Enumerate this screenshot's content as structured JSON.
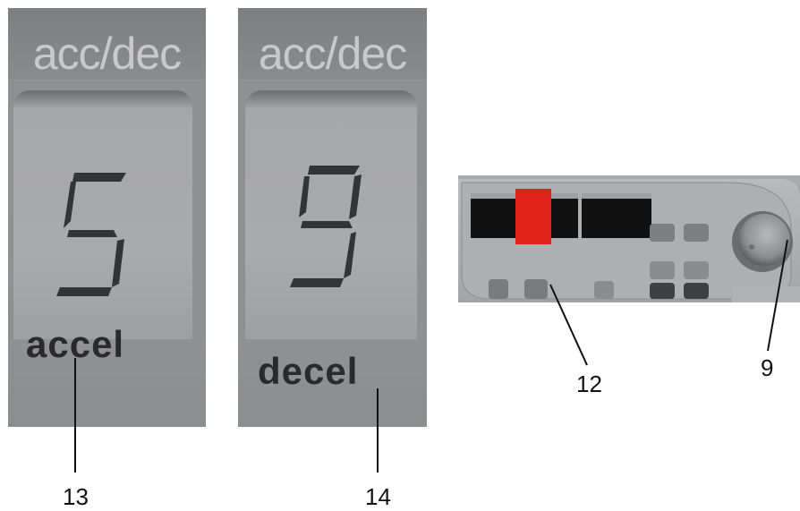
{
  "panels": [
    {
      "header": "acc/dec",
      "digit": "5",
      "label": "accel",
      "callout": "13"
    },
    {
      "header": "acc/dec",
      "digit": "9",
      "label": "decel",
      "callout": "14"
    }
  ],
  "device": {
    "callouts": {
      "buttons": "12",
      "knob": "9"
    },
    "highlight_color": "#e0211b"
  }
}
